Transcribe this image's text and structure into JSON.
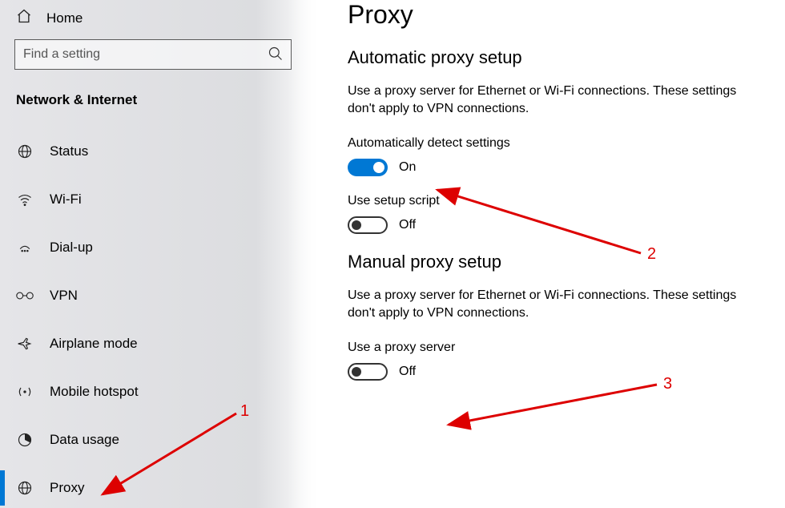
{
  "sidebar": {
    "home_label": "Home",
    "search_placeholder": "Find a setting",
    "category": "Network & Internet",
    "items": [
      {
        "label": "Status",
        "icon": "globe"
      },
      {
        "label": "Wi-Fi",
        "icon": "wifi"
      },
      {
        "label": "Dial-up",
        "icon": "dialup"
      },
      {
        "label": "VPN",
        "icon": "vpn"
      },
      {
        "label": "Airplane mode",
        "icon": "airplane"
      },
      {
        "label": "Mobile hotspot",
        "icon": "hotspot"
      },
      {
        "label": "Data usage",
        "icon": "data"
      },
      {
        "label": "Proxy",
        "icon": "globe"
      }
    ],
    "active_index": 7
  },
  "main": {
    "title": "Proxy",
    "auto": {
      "heading": "Automatic proxy setup",
      "desc": "Use a proxy server for Ethernet or Wi-Fi connections. These settings don't apply to VPN connections.",
      "detect_label": "Automatically detect settings",
      "detect_state": "On",
      "script_label": "Use setup script",
      "script_state": "Off"
    },
    "manual": {
      "heading": "Manual proxy setup",
      "desc": "Use a proxy server for Ethernet or Wi-Fi connections. These settings don't apply to VPN connections.",
      "use_label": "Use a proxy server",
      "use_state": "Off"
    }
  },
  "annotations": {
    "n1": "1",
    "n2": "2",
    "n3": "3"
  }
}
